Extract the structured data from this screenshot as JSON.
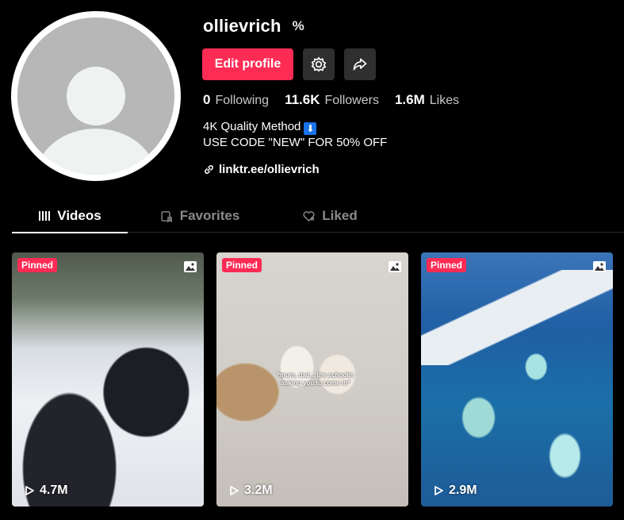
{
  "profile": {
    "username": "ollievrich",
    "badge": "%",
    "edit_label": "Edit profile",
    "stats": [
      {
        "num": "0",
        "label": "Following"
      },
      {
        "num": "11.6K",
        "label": "Followers"
      },
      {
        "num": "1.6M",
        "label": "Likes"
      }
    ],
    "bio_line1": "4K Quality Method",
    "bio_emoji": "⬇",
    "bio_line2": "USE CODE \"NEW\" FOR 50% OFF",
    "link": "linktr.ee/ollievrich"
  },
  "tabs": [
    {
      "label": "Videos",
      "icon": "grid-lines-icon",
      "active": true
    },
    {
      "label": "Favorites",
      "icon": "bookmark-icon",
      "active": false
    },
    {
      "label": "Liked",
      "icon": "heart-icon",
      "active": false
    }
  ],
  "videos": [
    {
      "pinned": "Pinned",
      "views": "4.7M",
      "caption": ""
    },
    {
      "pinned": "Pinned",
      "views": "3.2M",
      "caption": "*mum, dad... the schoolis asking you to come in*"
    },
    {
      "pinned": "Pinned",
      "views": "2.9M",
      "caption": ""
    }
  ],
  "colors": {
    "accent": "#fe2c55",
    "background": "#000000",
    "button_dark": "#2f2f2f"
  }
}
